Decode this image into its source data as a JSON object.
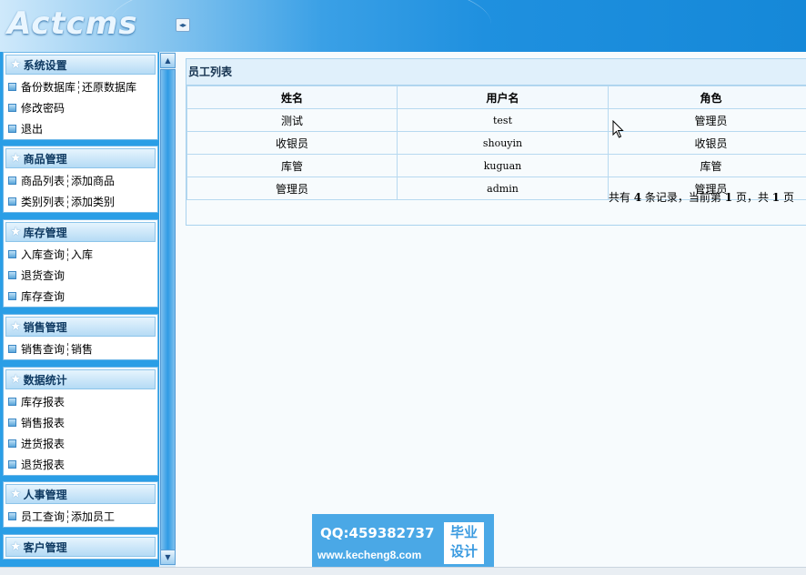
{
  "header": {
    "logo": "Actcms"
  },
  "sidebar": {
    "groups": [
      {
        "title": "系统设置",
        "rows": [
          {
            "items": [
              "备份数据库",
              "还原数据库"
            ]
          },
          {
            "items": [
              "修改密码"
            ]
          },
          {
            "items": [
              "退出"
            ]
          }
        ]
      },
      {
        "title": "商品管理",
        "rows": [
          {
            "items": [
              "商品列表",
              "添加商品"
            ]
          },
          {
            "items": [
              "类别列表",
              "添加类别"
            ]
          }
        ]
      },
      {
        "title": "库存管理",
        "rows": [
          {
            "items": [
              "入库查询",
              "入库"
            ]
          },
          {
            "items": [
              "退货查询"
            ]
          },
          {
            "items": [
              "库存查询"
            ]
          }
        ]
      },
      {
        "title": "销售管理",
        "rows": [
          {
            "items": [
              "销售查询",
              "销售"
            ]
          }
        ]
      },
      {
        "title": "数据统计",
        "rows": [
          {
            "items": [
              "库存报表"
            ]
          },
          {
            "items": [
              "销售报表"
            ]
          },
          {
            "items": [
              "进货报表"
            ]
          },
          {
            "items": [
              "退货报表"
            ]
          }
        ]
      },
      {
        "title": "人事管理",
        "rows": [
          {
            "items": [
              "员工查询",
              "添加员工"
            ]
          }
        ]
      },
      {
        "title": "客户管理",
        "rows": []
      }
    ]
  },
  "main": {
    "title": "员工列表",
    "columns": [
      "姓名",
      "用户名",
      "角色"
    ],
    "rows": [
      [
        "测试",
        "test",
        "管理员"
      ],
      [
        "收银员",
        "shouyin",
        "收银员"
      ],
      [
        "库管",
        "kuguan",
        "库管"
      ],
      [
        "管理员",
        "admin",
        "管理员"
      ]
    ],
    "pager": {
      "prefix": "共有",
      "total": "4",
      "mid1": "条记录，当前第",
      "page": "1",
      "mid2": "页，共",
      "pages": "1",
      "suffix": "页"
    }
  },
  "watermark": {
    "qq": "QQ:459382737",
    "url": "www.kecheng8.com",
    "badge_line1": "毕业",
    "badge_line2": "设计"
  }
}
